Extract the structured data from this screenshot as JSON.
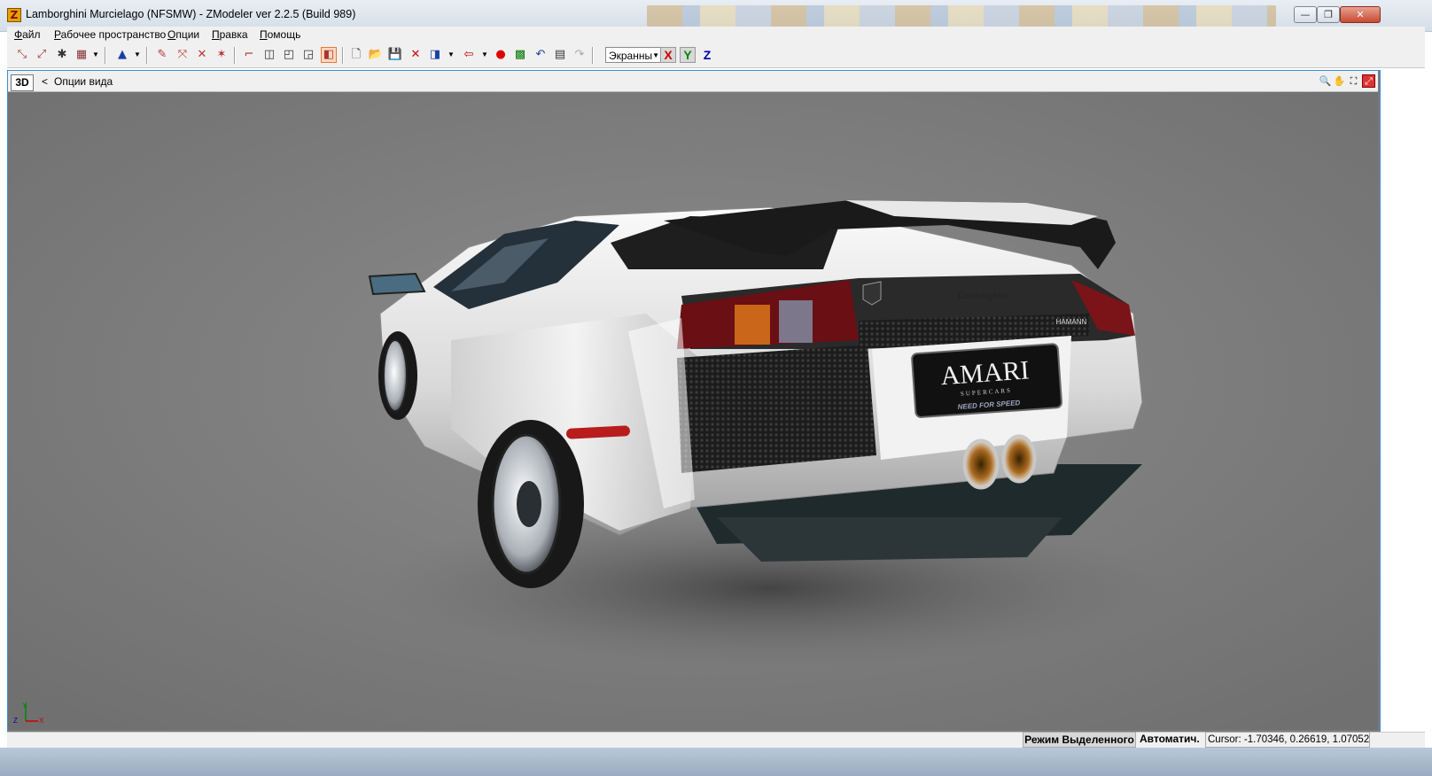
{
  "window": {
    "title": "Lamborghini Murcielago  (NFSMW) - ZModeler ver 2.2.5 (Build 989)",
    "app_icon_letter": "Z",
    "minimize_glyph": "—",
    "maximize_glyph": "❐",
    "close_glyph": "✕"
  },
  "menu": {
    "items": [
      "Файл",
      "Рабочее пространство",
      "Опции",
      "Правка",
      "Помощь"
    ]
  },
  "toolbar": {
    "screen_select_value": "Экранны",
    "axis_x": "X",
    "axis_y": "Y",
    "axis_z": "Z"
  },
  "viewport": {
    "mode_label": "3D",
    "back_arrow": "<",
    "options_label": "Опции вида",
    "background_color": "#7b7b7b",
    "plate_text": "AMARI",
    "plate_subtext": "SUPERCARS",
    "plate_footer": "NEED FOR SPEED",
    "car_badge": "Lamborghini",
    "hamann_badge": "HAMANN",
    "axis_gizmo": {
      "y": "Y",
      "z": "Z",
      "x": "X"
    }
  },
  "status": {
    "mode": "Режим Выделенного",
    "auto": "Автоматич.",
    "cursor": "Cursor: -1.70346, 0.26619, 1.07052"
  },
  "colors": {
    "viewport_border": "#3b8fd8",
    "axis_x": "#cc0000",
    "axis_y": "#008800",
    "axis_z": "#0000aa"
  }
}
